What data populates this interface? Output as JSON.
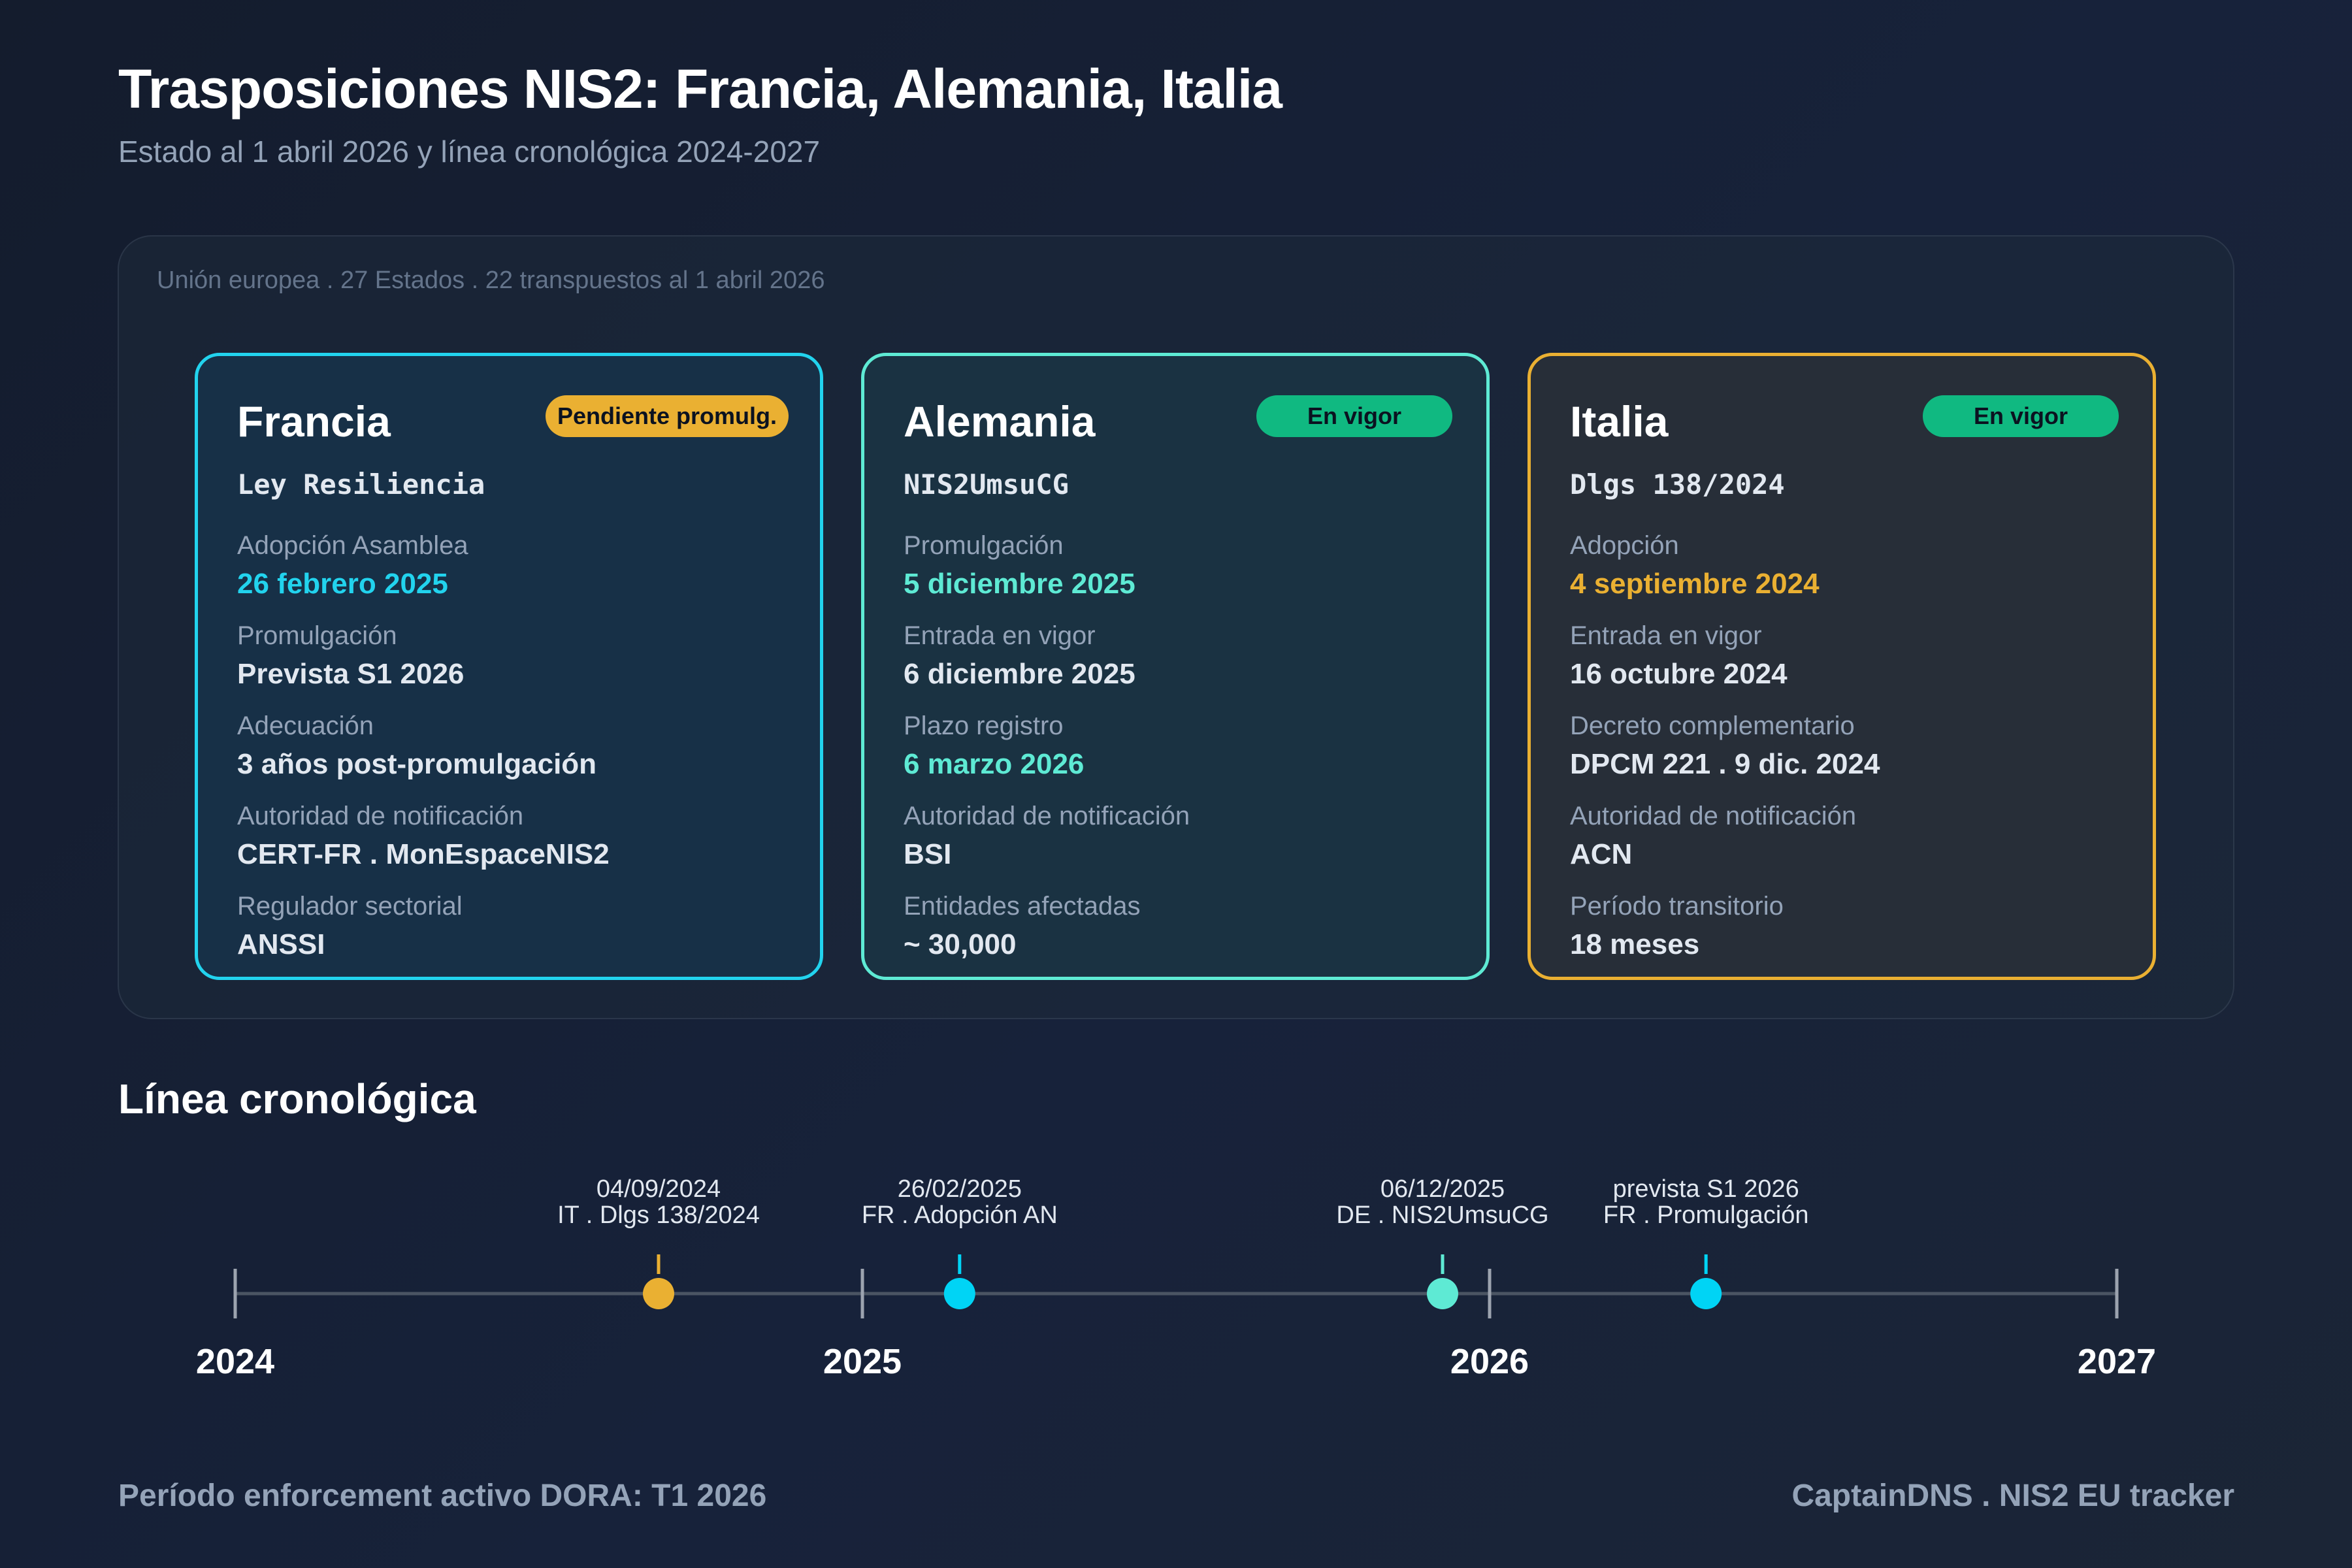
{
  "header": {
    "title": "Trasposiciones NIS2: Francia, Alemania, Italia",
    "subtitle": "Estado al 1 abril 2026 y línea cronológica 2024-2027"
  },
  "panel": {
    "caption": "Unión europea . 27 Estados . 22 transpuestos al 1 abril 2026"
  },
  "cards": [
    {
      "name": "Francia",
      "badge": "Pendiente promulg.",
      "badge_color": "#eab032",
      "border_color": "#22d3ee",
      "law": "Ley Resiliencia",
      "fields": [
        {
          "label": "Adopción Asamblea",
          "value": "26 febrero 2025"
        },
        {
          "label": "Promulgación",
          "value": "Prevista S1 2026"
        },
        {
          "label": "Adecuación",
          "value": "3 años post-promulgación"
        },
        {
          "label": "Autoridad de notificación",
          "value": "CERT-FR . MonEspaceNIS2"
        },
        {
          "label": "Regulador sectorial",
          "value": "ANSSI"
        }
      ]
    },
    {
      "name": "Alemania",
      "badge": "En vigor",
      "badge_color": "#10b981",
      "border_color": "#5eead4",
      "law": "NIS2UmsuCG",
      "fields": [
        {
          "label": "Promulgación",
          "value": "5 diciembre 2025"
        },
        {
          "label": "Entrada en vigor",
          "value": "6 diciembre 2025"
        },
        {
          "label": "Plazo registro",
          "value": "6 marzo 2026"
        },
        {
          "label": "Autoridad de notificación",
          "value": "BSI"
        },
        {
          "label": "Entidades afectadas",
          "value": "~ 30,000"
        }
      ]
    },
    {
      "name": "Italia",
      "badge": "En vigor",
      "badge_color": "#10b981",
      "border_color": "#eab032",
      "law": "Dlgs 138/2024",
      "fields": [
        {
          "label": "Adopción",
          "value": "4 septiembre 2024"
        },
        {
          "label": "Entrada en vigor",
          "value": "16 octubre 2024"
        },
        {
          "label": "Decreto complementario",
          "value": "DPCM 221 . 9 dic. 2024"
        },
        {
          "label": "Autoridad de notificación",
          "value": "ACN"
        },
        {
          "label": "Período transitorio",
          "value": "18 meses"
        }
      ]
    }
  ],
  "timeline": {
    "title": "Línea cronológica",
    "years": [
      "2024",
      "2025",
      "2026",
      "2027"
    ],
    "events": [
      {
        "date": "04/09/2024",
        "label": "IT . Dlgs 138/2024",
        "t": 2024.675,
        "color": "#eab032"
      },
      {
        "date": "26/02/2025",
        "label": "FR . Adopción AN",
        "t": 2025.155,
        "color": "#00d4f5"
      },
      {
        "date": "06/12/2025",
        "label": "DE . NIS2UmsuCG",
        "t": 2025.925,
        "color": "#5eead4"
      },
      {
        "date": "prevista S1 2026",
        "label": "FR . Promulgación",
        "t": 2026.345,
        "color": "#00d4f5"
      }
    ]
  },
  "footer": {
    "left": "Período enforcement activo DORA: T1 2026",
    "right": "CaptainDNS . NIS2 EU tracker"
  }
}
